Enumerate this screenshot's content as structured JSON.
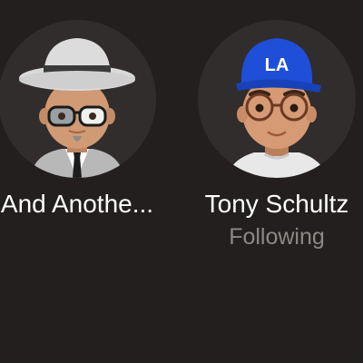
{
  "contacts": [
    {
      "name": "And Anothe...",
      "status": "",
      "avatar_icon": "memoji-hat-glasses-suit-avatar"
    },
    {
      "name": "Tony Schultz",
      "status": "Following",
      "avatar_icon": "memoji-cap-glasses-avatar",
      "cap_logo": "LA"
    }
  ],
  "colors": {
    "background": "#221f1e",
    "avatar_bg": "#302d2c",
    "name_text": "#ffffff",
    "status_text": "#8b8886",
    "cap_blue": "#1f4ed8"
  }
}
